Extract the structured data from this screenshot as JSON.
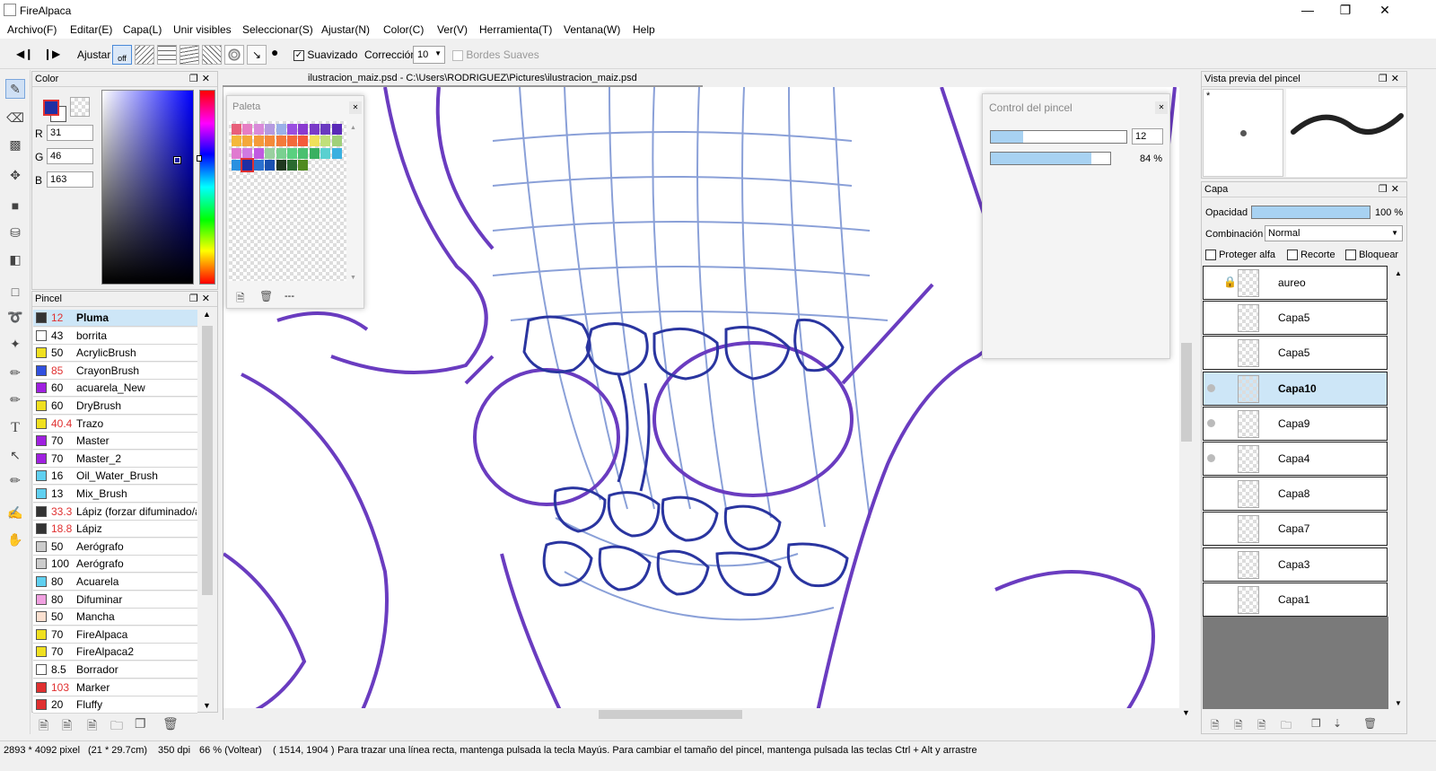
{
  "app": {
    "title": "FireAlpaca"
  },
  "menu": [
    "Archivo(F)",
    "Editar(E)",
    "Capa(L)",
    "Unir visibles",
    "Seleccionar(S)",
    "Ajustar(N)",
    "Color(C)",
    "Ver(V)",
    "Herramienta(T)",
    "Ventana(W)",
    "Help"
  ],
  "toolbar": {
    "ajustar": "Ajustar",
    "off": "off",
    "suavizado": "Suavizado",
    "correccion": "Corrección",
    "correccion_value": "10",
    "bordes": "Bordes Suaves"
  },
  "canvas": {
    "tab_title": "ilustracion_maiz.psd - C:\\Users\\RODRIGUEZ\\Pictures\\ilustracion_maiz.psd"
  },
  "color_panel": {
    "title": "Color",
    "r_label": "R",
    "g_label": "G",
    "b_label": "B",
    "r": "31",
    "g": "46",
    "b": "163",
    "fg_color": "#1f2ea3"
  },
  "palette": {
    "title": "Paleta",
    "more": "---",
    "colors": [
      "#e8607a",
      "#e67ec4",
      "#d98ad9",
      "#b59ae0",
      "#9ab0e8",
      "#9a4ee0",
      "#8a3ad0",
      "#7a3ac8",
      "#6a3ac0",
      "#5a2ab8",
      "#f4b83a",
      "#f4a83a",
      "#f49a3a",
      "#f48a3a",
      "#f47a3a",
      "#f46a3a",
      "#f45a3a",
      "#f0e05a",
      "#c0e07a",
      "#a0d07a",
      "#e07ad0",
      "#d07ae0",
      "#c05ae0",
      "#9ad0a0",
      "#7ad090",
      "#5ad080",
      "#4ac070",
      "#3ab060",
      "#5ad0d0",
      "#3ab0e0",
      "#2a90e0",
      "#1f2ea3",
      "#2a70d0",
      "#1a50b0",
      "#203820",
      "#2a6a30",
      "#508a20"
    ]
  },
  "brush_panel": {
    "title": "Pincel",
    "items": [
      {
        "size": "12",
        "name": "Pluma",
        "color": "#333333",
        "red": true,
        "selected": true
      },
      {
        "size": "43",
        "name": "borrita",
        "color": "#ffffff",
        "red": false
      },
      {
        "size": "50",
        "name": "AcrylicBrush",
        "color": "#f0e020",
        "red": false
      },
      {
        "size": "85",
        "name": "CrayonBrush",
        "color": "#3050e0",
        "red": true
      },
      {
        "size": "60",
        "name": "acuarela_New",
        "color": "#a020e0",
        "red": false
      },
      {
        "size": "60",
        "name": "DryBrush",
        "color": "#f0e020",
        "red": false
      },
      {
        "size": "40.4",
        "name": "Trazo",
        "color": "#f0e020",
        "red": true
      },
      {
        "size": "70",
        "name": "Master",
        "color": "#a020e0",
        "red": false
      },
      {
        "size": "70",
        "name": "Master_2",
        "color": "#a020e0",
        "red": false
      },
      {
        "size": "16",
        "name": "Oil_Water_Brush",
        "color": "#60d0f0",
        "red": false
      },
      {
        "size": "13",
        "name": "Mix_Brush",
        "color": "#60d0f0",
        "red": false
      },
      {
        "size": "33.3",
        "name": "Lápiz (forzar difuminado/a",
        "color": "#333333",
        "red": true
      },
      {
        "size": "18.8",
        "name": "Lápiz",
        "color": "#333333",
        "red": true
      },
      {
        "size": "50",
        "name": "Aerógrafo",
        "color": "#cccccc",
        "red": false
      },
      {
        "size": "100",
        "name": "Aerógrafo",
        "color": "#cccccc",
        "red": false
      },
      {
        "size": "80",
        "name": "Acuarela",
        "color": "#60d0f0",
        "red": false
      },
      {
        "size": "80",
        "name": "Difuminar",
        "color": "#f0a0e0",
        "red": false
      },
      {
        "size": "50",
        "name": "Mancha",
        "color": "#fbe0d0",
        "red": false
      },
      {
        "size": "70",
        "name": "FireAlpaca",
        "color": "#f0e020",
        "red": false
      },
      {
        "size": "70",
        "name": "FireAlpaca2",
        "color": "#f0e020",
        "red": false
      },
      {
        "size": "8.5",
        "name": "Borrador",
        "color": "#ffffff",
        "red": false
      },
      {
        "size": "103",
        "name": "Marker",
        "color": "#e03030",
        "red": true
      },
      {
        "size": "20",
        "name": "Fluffy",
        "color": "#e03030",
        "red": false
      }
    ]
  },
  "brush_control": {
    "title": "Control del pincel",
    "size_value": "12",
    "size_fraction": 0.12,
    "opacity_value": "84 %",
    "opacity_fraction": 0.84
  },
  "brush_preview": {
    "title": "Vista previa del pincel",
    "star": "*"
  },
  "layer_panel": {
    "title": "Capa",
    "opacity_label": "Opacidad",
    "opacity_value": "100 %",
    "opacity_fraction": 1.0,
    "blend_label": "Combinación",
    "blend_value": "Normal",
    "protect_alpha": "Proteger alfa",
    "clip": "Recorte",
    "lock": "Bloquear",
    "layers": [
      {
        "name": "aureo",
        "locked": true,
        "eye": false,
        "selected": false
      },
      {
        "name": "Capa5",
        "locked": false,
        "eye": false,
        "selected": false
      },
      {
        "name": "Capa5",
        "locked": false,
        "eye": false,
        "selected": false
      },
      {
        "name": "Capa10",
        "locked": false,
        "eye": true,
        "selected": true
      },
      {
        "name": "Capa9",
        "locked": false,
        "eye": true,
        "selected": false
      },
      {
        "name": "Capa4",
        "locked": false,
        "eye": true,
        "selected": false
      },
      {
        "name": "Capa8",
        "locked": false,
        "eye": false,
        "selected": false
      },
      {
        "name": "Capa7",
        "locked": false,
        "eye": false,
        "selected": false
      },
      {
        "name": "Capa3",
        "locked": false,
        "eye": false,
        "selected": false
      },
      {
        "name": "Capa1",
        "locked": false,
        "eye": false,
        "selected": false
      }
    ]
  },
  "status": {
    "dimensions": "2893 * 4092 pixel",
    "cm": "(21 * 29.7cm)",
    "dpi": "350 dpi",
    "zoom": "66 % (Voltear)",
    "coords": "( 1514, 1904 )",
    "hint": "Para trazar una línea recta, mantenga pulsada la tecla Mayús. Para cambiar el tamaño del pincel, mantenga pulsada las teclas Ctrl + Alt y arrastre"
  }
}
